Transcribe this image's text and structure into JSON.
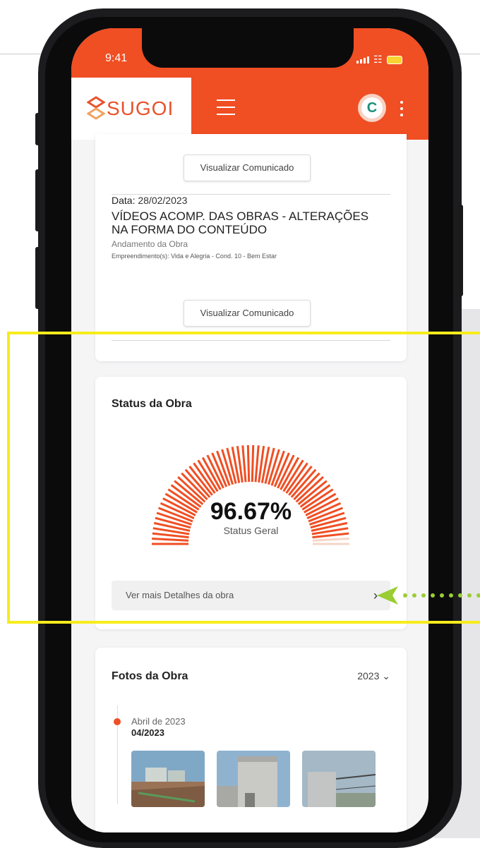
{
  "status_bar": {
    "time": "9:41"
  },
  "app_bar": {
    "brand": "SUGOI",
    "avatar_letter": "C"
  },
  "announcements": {
    "button_label": "Visualizar Comunicado",
    "item": {
      "date_label": "Data:",
      "date": "28/02/2023",
      "title": "VÍDEOS ACOMP. DAS OBRAS - ALTERAÇÕES NA FORMA DO CONTEÚDO",
      "category": "Andamento da Obra",
      "developments_label": "Empreendimento(s):",
      "developments": "Vida e Alegria - Cond. 10 - Bem Estar"
    }
  },
  "status_card": {
    "title": "Status da Obra",
    "percent_text": "96.67%",
    "percent_value": 0.9667,
    "percent_label": "Status Geral",
    "details_link": "Ver mais Detalhes da obra"
  },
  "photos_card": {
    "title": "Fotos da Obra",
    "year": "2023",
    "entries": [
      {
        "month": "Abril de 2023",
        "code": "04/2023"
      }
    ]
  },
  "colors": {
    "brand_orange": "#f04e23",
    "gauge_empty": "#f6d5c8",
    "highlight": "#f7ec1b",
    "arrow_green": "#9acd32"
  }
}
